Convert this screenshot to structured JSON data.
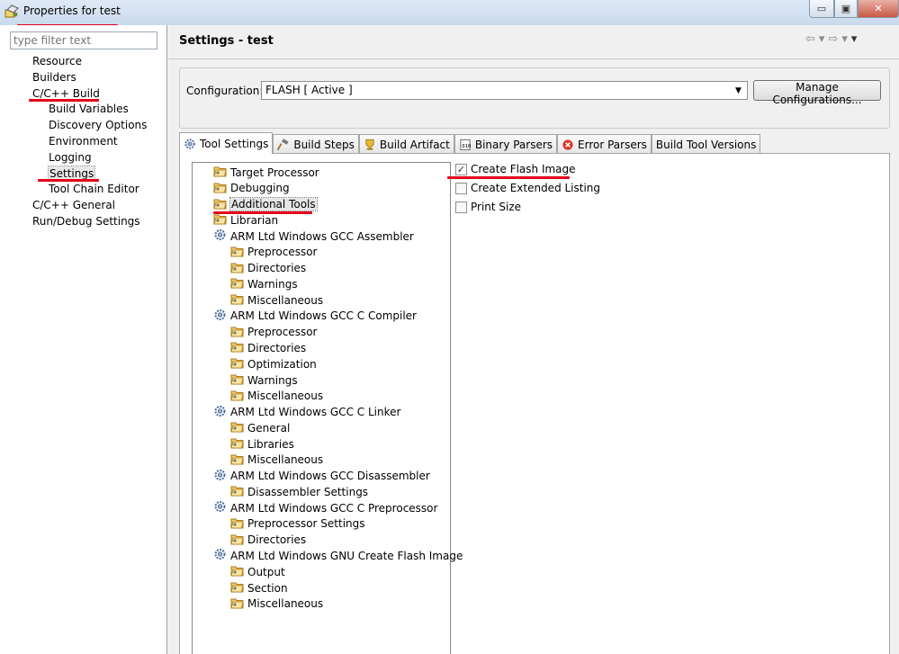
{
  "window": {
    "title": "Properties for test",
    "min": "▭",
    "max": "▣",
    "close": "✕"
  },
  "left": {
    "filter_placeholder": "type filter text",
    "items": [
      {
        "label": "Resource",
        "level": 0
      },
      {
        "label": "Builders",
        "level": 0
      },
      {
        "label": "C/C++ Build",
        "level": 0
      },
      {
        "label": "Build Variables",
        "level": 1
      },
      {
        "label": "Discovery Options",
        "level": 1
      },
      {
        "label": "Environment",
        "level": 1
      },
      {
        "label": "Logging",
        "level": 1
      },
      {
        "label": "Settings",
        "level": 1,
        "selected": true
      },
      {
        "label": "Tool Chain Editor",
        "level": 1
      },
      {
        "label": "C/C++ General",
        "level": 0
      },
      {
        "label": "Run/Debug Settings",
        "level": 0
      }
    ]
  },
  "header": {
    "title": "Settings - test",
    "back": "⇦",
    "forward": "⇨",
    "menu": "▾"
  },
  "configuration": {
    "label": "Configuration:",
    "value": "FLASH  [ Active ]",
    "manage_label": "Manage Configurations..."
  },
  "tabs": [
    {
      "label": "Tool Settings",
      "icon": "gear-icon",
      "active": true
    },
    {
      "label": "Build Steps",
      "icon": "hammer-icon"
    },
    {
      "label": "Build Artifact",
      "icon": "trophy-icon"
    },
    {
      "label": "Binary Parsers",
      "icon": "binary-icon"
    },
    {
      "label": "Error Parsers",
      "icon": "error-icon"
    },
    {
      "label": "Build Tool Versions",
      "icon": ""
    }
  ],
  "tree": [
    {
      "label": "Target Processor",
      "level": 0,
      "icon": "folder-icon"
    },
    {
      "label": "Debugging",
      "level": 0,
      "icon": "folder-icon"
    },
    {
      "label": "Additional Tools",
      "level": 0,
      "icon": "folder-icon",
      "selected": true
    },
    {
      "label": "Librarian",
      "level": 0,
      "icon": "folder-icon"
    },
    {
      "label": "ARM Ltd Windows GCC Assembler",
      "level": 0,
      "icon": "gear-icon"
    },
    {
      "label": "Preprocessor",
      "level": 1,
      "icon": "folder-icon"
    },
    {
      "label": "Directories",
      "level": 1,
      "icon": "folder-icon"
    },
    {
      "label": "Warnings",
      "level": 1,
      "icon": "folder-icon"
    },
    {
      "label": "Miscellaneous",
      "level": 1,
      "icon": "folder-icon"
    },
    {
      "label": "ARM Ltd Windows GCC C Compiler",
      "level": 0,
      "icon": "gear-icon"
    },
    {
      "label": "Preprocessor",
      "level": 1,
      "icon": "folder-icon"
    },
    {
      "label": "Directories",
      "level": 1,
      "icon": "folder-icon"
    },
    {
      "label": "Optimization",
      "level": 1,
      "icon": "folder-icon"
    },
    {
      "label": "Warnings",
      "level": 1,
      "icon": "folder-icon"
    },
    {
      "label": "Miscellaneous",
      "level": 1,
      "icon": "folder-icon"
    },
    {
      "label": "ARM Ltd Windows GCC C Linker",
      "level": 0,
      "icon": "gear-icon"
    },
    {
      "label": "General",
      "level": 1,
      "icon": "folder-icon"
    },
    {
      "label": "Libraries",
      "level": 1,
      "icon": "folder-icon"
    },
    {
      "label": "Miscellaneous",
      "level": 1,
      "icon": "folder-icon"
    },
    {
      "label": "ARM Ltd Windows GCC Disassembler",
      "level": 0,
      "icon": "gear-icon"
    },
    {
      "label": "Disassembler Settings",
      "level": 1,
      "icon": "folder-icon"
    },
    {
      "label": "ARM Ltd Windows GCC C Preprocessor",
      "level": 0,
      "icon": "gear-icon"
    },
    {
      "label": "Preprocessor Settings",
      "level": 1,
      "icon": "folder-icon"
    },
    {
      "label": "Directories",
      "level": 1,
      "icon": "folder-icon"
    },
    {
      "label": "ARM Ltd Windows GNU Create Flash Image",
      "level": 0,
      "icon": "gear-icon"
    },
    {
      "label": "Output",
      "level": 1,
      "icon": "folder-icon"
    },
    {
      "label": "Section",
      "level": 1,
      "icon": "folder-icon"
    },
    {
      "label": "Miscellaneous",
      "level": 1,
      "icon": "folder-icon"
    }
  ],
  "options": [
    {
      "label": "Create Flash Image",
      "checked": true
    },
    {
      "label": "Create Extended Listing",
      "checked": false
    },
    {
      "label": "Print Size",
      "checked": false
    }
  ],
  "colors": {
    "highlight_underline": "#e3001b",
    "folder": "#e8b84a",
    "gear": "#4a6a9c"
  }
}
